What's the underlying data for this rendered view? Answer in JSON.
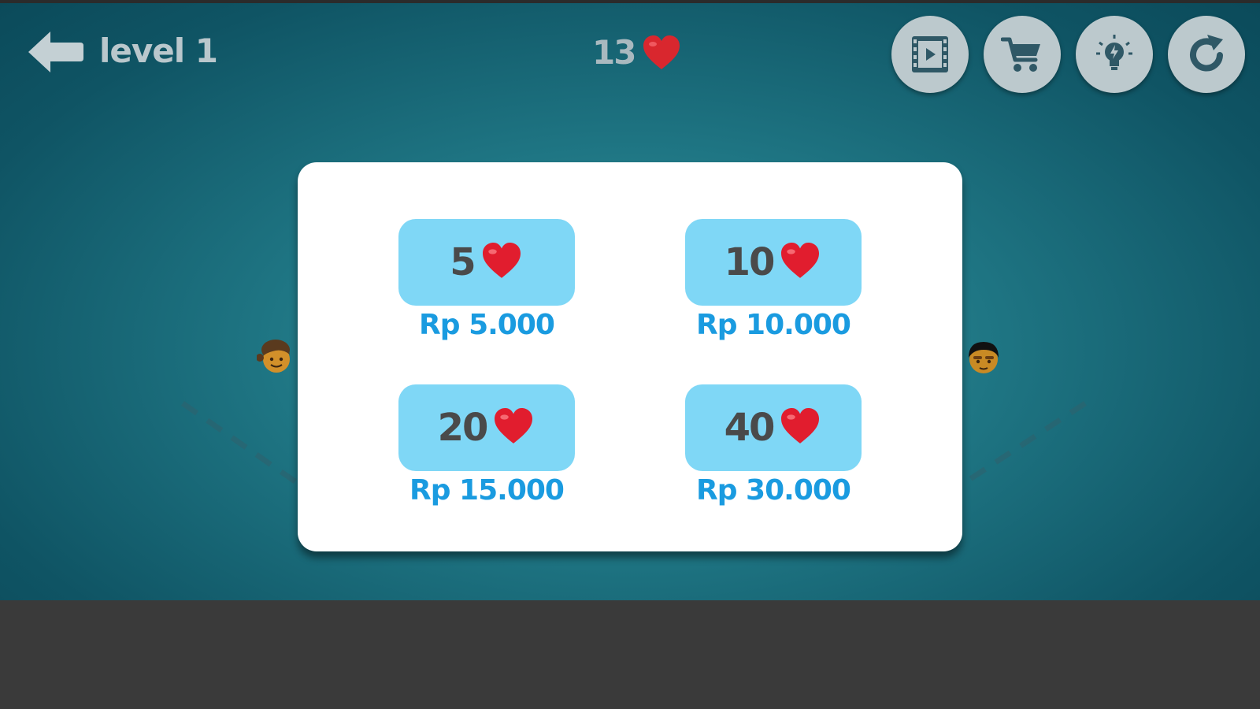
{
  "header": {
    "level_label": "level 1",
    "hearts_count": "13",
    "heart_icon": "heart-icon",
    "back_icon": "back-arrow-icon"
  },
  "toolbar": {
    "buttons": [
      {
        "name": "watch-video-button",
        "icon": "film-play-icon"
      },
      {
        "name": "shop-button",
        "icon": "cart-icon"
      },
      {
        "name": "hint-button",
        "icon": "lightbulb-icon"
      },
      {
        "name": "restart-button",
        "icon": "restart-icon"
      }
    ]
  },
  "shop": {
    "offers": [
      {
        "amount": "5",
        "price": "Rp 5.000"
      },
      {
        "amount": "10",
        "price": "Rp 10.000"
      },
      {
        "amount": "20",
        "price": "Rp 15.000"
      },
      {
        "amount": "40",
        "price": "Rp 30.000"
      }
    ]
  },
  "characters": {
    "left": "girl-emoji-icon",
    "right": "boy-emoji-icon"
  },
  "colors": {
    "background": "#1f7684",
    "offer_button": "#7fd7f6",
    "price_text": "#1a9be0",
    "heart": "#e11d2e",
    "round_button": "#bcc9cd",
    "bottom_bar": "#3a3a3a"
  }
}
